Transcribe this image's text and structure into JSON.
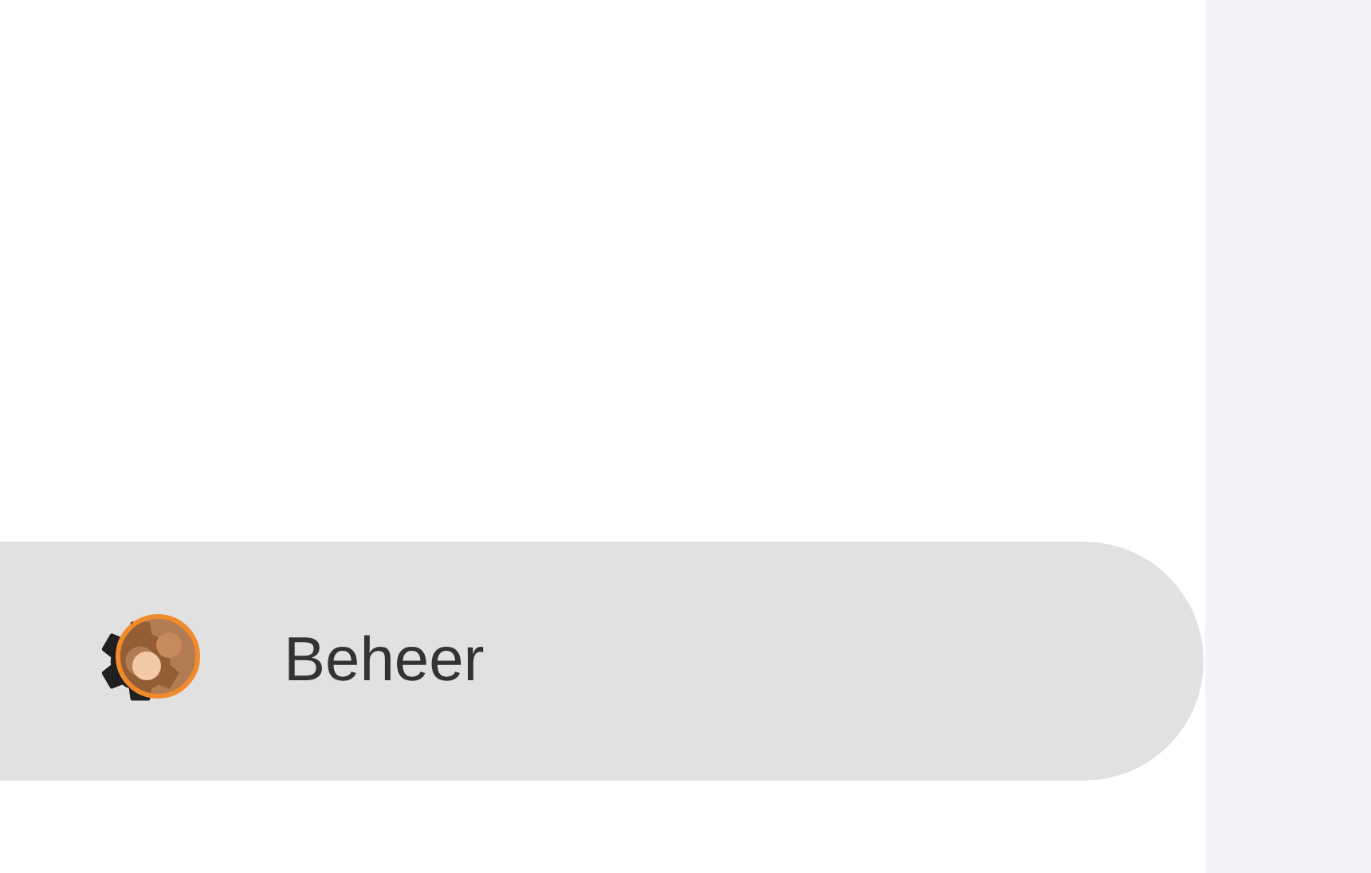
{
  "sidebar": {
    "items": [
      {
        "label": "Beheer",
        "selected": true
      }
    ]
  }
}
